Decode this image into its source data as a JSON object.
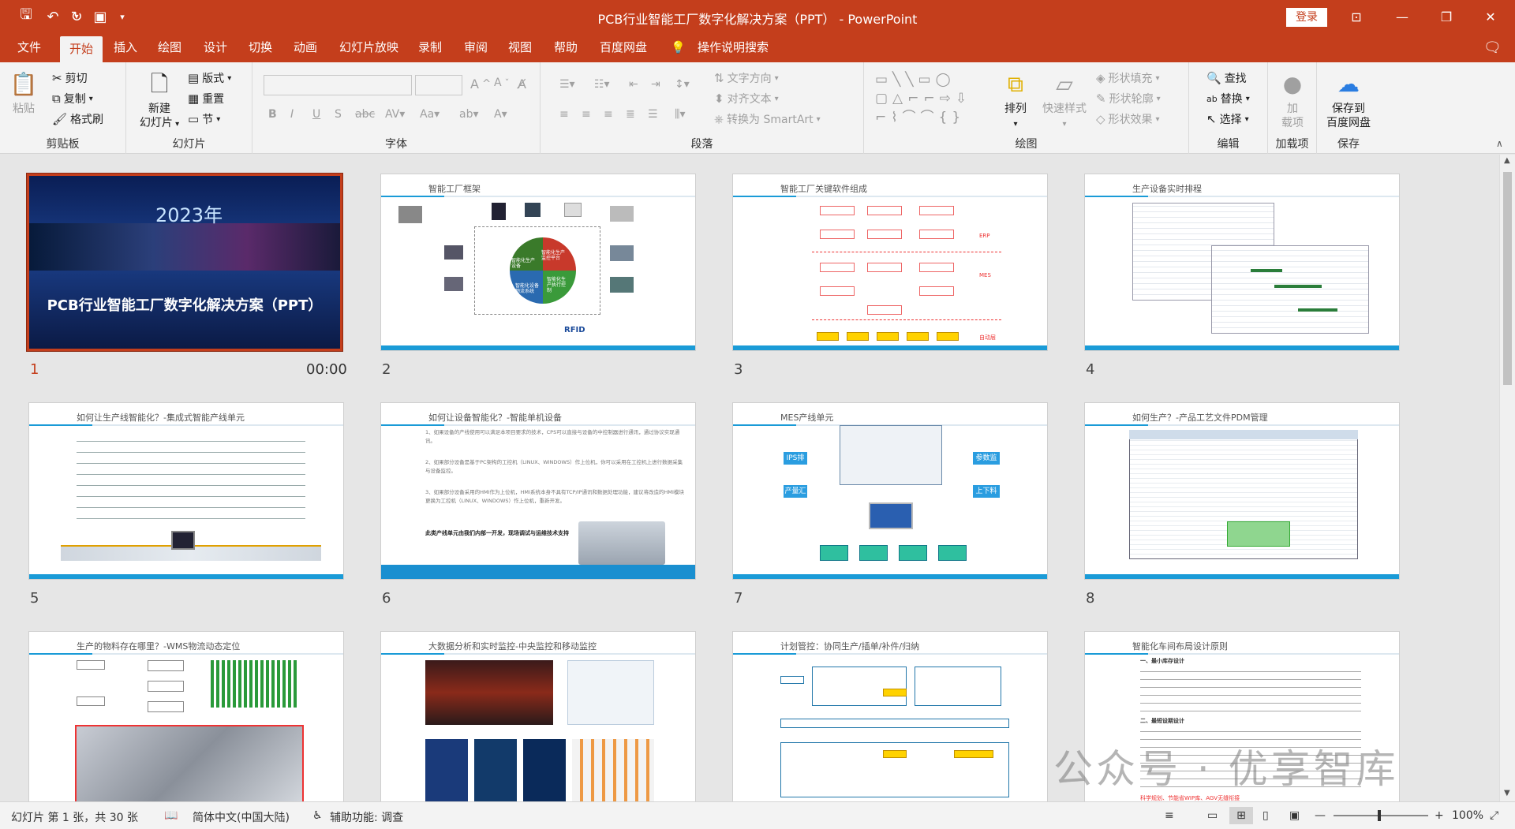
{
  "window": {
    "title": "PCB行业智能工厂数字化解决方案（PPT）  -  PowerPoint",
    "login": "登录",
    "accent": "#c43e1c"
  },
  "tabs": [
    {
      "label": "文件"
    },
    {
      "label": "开始"
    },
    {
      "label": "插入"
    },
    {
      "label": "绘图"
    },
    {
      "label": "设计"
    },
    {
      "label": "切换"
    },
    {
      "label": "动画"
    },
    {
      "label": "幻灯片放映"
    },
    {
      "label": "录制"
    },
    {
      "label": "审阅"
    },
    {
      "label": "视图"
    },
    {
      "label": "帮助"
    },
    {
      "label": "百度网盘"
    },
    {
      "label": "操作说明搜索"
    }
  ],
  "ribbon": {
    "clipboard": {
      "label": "剪贴板",
      "paste": "粘贴",
      "cut": "剪切",
      "copy": "复制",
      "format_painter": "格式刷"
    },
    "slides": {
      "label": "幻灯片",
      "new_slide_1": "新建",
      "new_slide_2": "幻灯片",
      "layout": "版式",
      "reset": "重置",
      "section": "节"
    },
    "font": {
      "label": "字体"
    },
    "paragraph": {
      "label": "段落",
      "text_direction": "文字方向",
      "align_text": "对齐文本",
      "smartart": "转换为 SmartArt"
    },
    "drawing": {
      "label": "绘图",
      "arrange": "排列",
      "quick_styles": "快速样式",
      "shape_fill": "形状填充",
      "shape_outline": "形状轮廓",
      "shape_effects": "形状效果"
    },
    "editing": {
      "label": "编辑",
      "find": "查找",
      "replace": "替换",
      "select": "选择"
    },
    "addins": {
      "label": "加载项",
      "addin_1": "加",
      "addin_2": "载项"
    },
    "save": {
      "label": "保存",
      "save_1": "保存到",
      "save_2": "百度网盘"
    }
  },
  "slides": [
    {
      "num": "1",
      "time": "00:00",
      "year": "2023年",
      "title": "PCB行业智能工厂数字化解决方案（PPT）"
    },
    {
      "num": "2",
      "title": "智能工厂框架"
    },
    {
      "num": "3",
      "title": "智能工厂关键软件组成"
    },
    {
      "num": "4",
      "title": "生产设备实时排程"
    },
    {
      "num": "5",
      "title": "如何让生产线智能化？-集成式智能产线单元"
    },
    {
      "num": "6",
      "title": "如何让设备智能化？-智能单机设备"
    },
    {
      "num": "7",
      "title": "MES产线单元"
    },
    {
      "num": "8",
      "title": "如何生产？-产品工艺文件PDM管理"
    },
    {
      "num": "9",
      "title": "生产的物料存在哪里？-WMS物流动态定位"
    },
    {
      "num": "10",
      "title": "大数据分析和实时监控-中央监控和移动监控"
    },
    {
      "num": "11",
      "title": "计划管控：协同生产/插单/补件/归纳"
    },
    {
      "num": "12",
      "title": "智能化车间布局设计原则"
    }
  ],
  "slide2": {
    "wheel": [
      "智能化生产监控平台",
      "智能化生产执行控制",
      "智能化设备物流系统",
      "智能化生产设备"
    ],
    "rfid": "RFID"
  },
  "slide3": {
    "labels": [
      "ERP",
      "MES",
      "自动层"
    ]
  },
  "slide6": {
    "bullets": [
      "1、如果设备的产线使用可以满足本项目要求的技术，CPS可以直接与设备的中控制器进行通讯，通过协议实现通讯。",
      "2、如果部分设备是基于PC架构的工控机（LINUX、WINDOWS）作上位机，你可以采用在工控机上进行数据采集与设备监控。",
      "3、如果部分设备采用的HMI作为上位机，HMI系统本身不具有TCP/IP通讯和数据处理功能，建议将改造的HMI模块更换为工控机（LINUX、WINDOWS）作上位机，重新开发。"
    ],
    "note": "此类产线单元由我们内部一开发，现场调试与运维技术支持"
  },
  "slide7": {
    "left": [
      "IPS排程",
      "产量汇报"
    ],
    "right": [
      "参数监控",
      "上下料呼叫"
    ]
  },
  "slide12": {
    "heading1": "一、最小库存设计",
    "heading2": "二、最短设期设计",
    "footer": "科学规划、节能省WIP库、AGV无缝衔接"
  },
  "status": {
    "slide_info": "幻灯片 第 1 张，共 30 张",
    "language": "简体中文(中国大陆)",
    "accessibility": "辅助功能: 调查",
    "zoom": "100%"
  },
  "watermark": "公众号 · 优享智库"
}
